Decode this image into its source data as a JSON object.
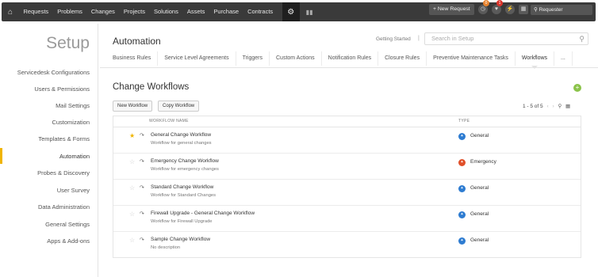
{
  "nav": {
    "items": [
      "Requests",
      "Problems",
      "Changes",
      "Projects",
      "Solutions",
      "Assets",
      "Purchase",
      "Contracts"
    ],
    "new_request": "+ New Request",
    "badges": [
      "0",
      "1"
    ],
    "search_label": "Requester"
  },
  "sidebar": {
    "title": "Setup",
    "items": [
      "Servicedesk Configurations",
      "Users & Permissions",
      "Mail Settings",
      "Customization",
      "Templates & Forms",
      "Automation",
      "Probes & Discovery",
      "User Survey",
      "Data Administration",
      "General Settings",
      "Apps & Add-ons"
    ],
    "active_index": 5,
    "accent": "#f0b400"
  },
  "header": {
    "title": "Automation",
    "getting_started": "Getting Started",
    "search_placeholder": "Search in Setup"
  },
  "tabs": [
    "Business Rules",
    "Service Level Agreements",
    "Triggers",
    "Custom Actions",
    "Notification Rules",
    "Closure Rules",
    "Preventive Maintenance Tasks",
    "Workflows",
    "..."
  ],
  "active_tab": "Workflows",
  "content": {
    "title": "Change Workflows",
    "new_button": "New Workflow",
    "copy_button": "Copy Workflow",
    "pagination": "1 - 5 of 5",
    "columns": {
      "name": "Workflow Name",
      "type": "Type"
    },
    "rows": [
      {
        "name": "General Change Workflow",
        "desc": "Workflow for general changes",
        "type": "General",
        "fav": true
      },
      {
        "name": "Emergency Change Workflow",
        "desc": "Workflow for emergency changes",
        "type": "Emergency",
        "fav": false
      },
      {
        "name": "Standard Change Workflow",
        "desc": "Workflow for Standard Changes",
        "type": "General",
        "fav": false
      },
      {
        "name": "Firewall Upgrade - General Change Workflow",
        "desc": "Workflow for Firewall Upgrade",
        "type": "General",
        "fav": false
      },
      {
        "name": "Sample Change Workflow",
        "desc": "No description",
        "type": "General",
        "fav": false
      }
    ],
    "type_colors": {
      "General": "#2e7cd1",
      "Emergency": "#e0502a"
    }
  }
}
